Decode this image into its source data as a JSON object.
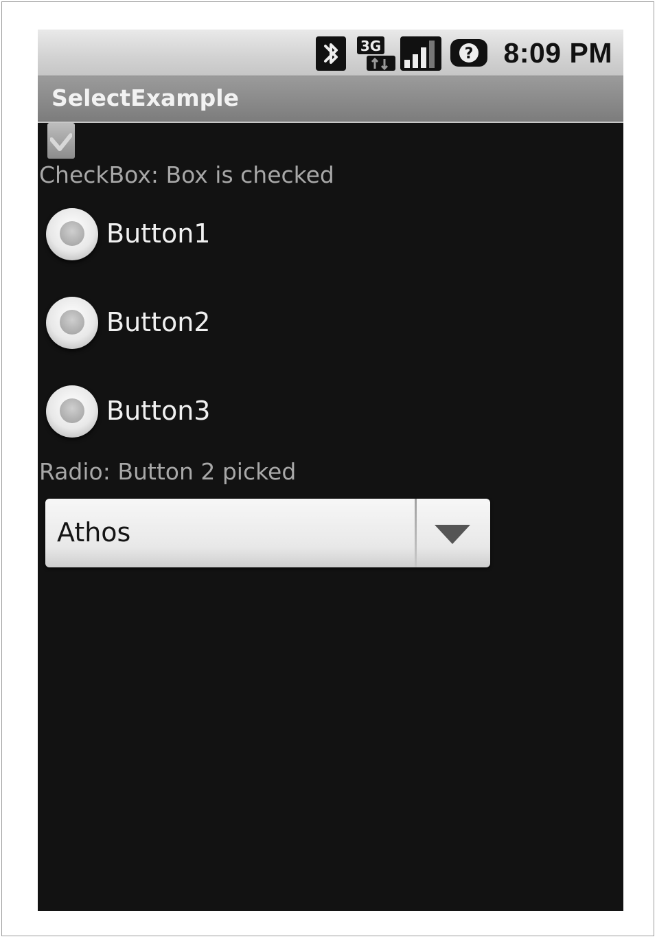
{
  "status_bar": {
    "time": "8:09 PM",
    "icons": [
      "bluetooth-icon",
      "3g-icon",
      "signal-icon",
      "help-icon"
    ]
  },
  "app": {
    "title": "SelectExample"
  },
  "checkbox": {
    "checked": true,
    "status_text": "CheckBox: Box is checked"
  },
  "radio_group": {
    "buttons": [
      {
        "label": "Button1"
      },
      {
        "label": "Button2"
      },
      {
        "label": "Button3"
      }
    ],
    "status_text": "Radio: Button 2 picked"
  },
  "spinner": {
    "selected": "Athos"
  },
  "colors": {
    "screen_background": "#121212",
    "title_bar": "#8a8a8a",
    "status_text": "#a8a8a8"
  }
}
